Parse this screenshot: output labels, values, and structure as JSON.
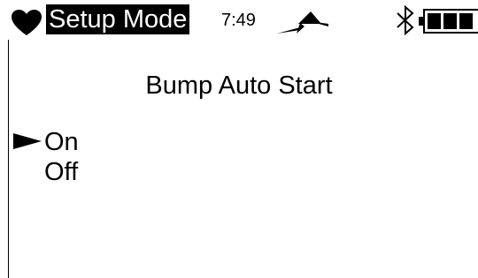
{
  "status_bar": {
    "mode": "Setup Mode",
    "time": "7:49",
    "icons": {
      "heart": "heart-icon",
      "pump": "pump-status-icon",
      "bluetooth": "bluetooth-icon",
      "battery": "battery-icon"
    },
    "battery_level": 1.0
  },
  "screen": {
    "title": "Bump Auto Start",
    "options": [
      {
        "label": "On",
        "selected": true
      },
      {
        "label": "Off",
        "selected": false
      }
    ]
  },
  "colors": {
    "foreground": "#000000",
    "background": "#ffffff"
  }
}
